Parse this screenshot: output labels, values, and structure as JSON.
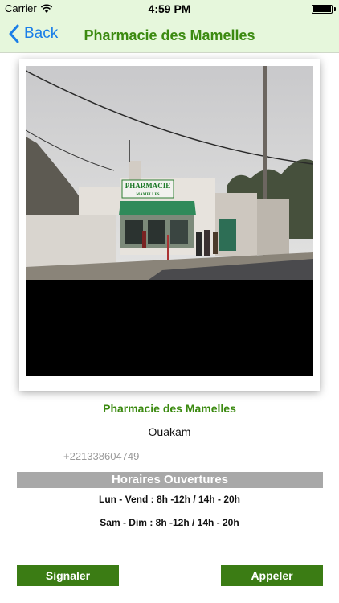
{
  "status_bar": {
    "carrier": "Carrier",
    "time": "4:59 PM",
    "battery_level": 1.0
  },
  "nav": {
    "back_label": "Back",
    "title": "Pharmacie des Mamelles"
  },
  "photo": {
    "sign_title": "PHARMACIE",
    "sign_subtitle": "MAMELLES"
  },
  "info": {
    "name": "Pharmacie des Mamelles",
    "district": "Ouakam",
    "phone": "+221338604749"
  },
  "hours": {
    "header": "Horaires Ouvertures",
    "weekdays": "Lun - Vend : 8h -12h  /  14h - 20h",
    "weekend": "Sam - Dim : 8h -12h  /  14h - 20h"
  },
  "actions": {
    "report_label": "Signaler",
    "call_label": "Appeler"
  },
  "colors": {
    "bar_background": "#e6f7dc",
    "accent_green": "#3b8a10",
    "button_green": "#3b7c14",
    "link_blue": "#1a7ee8",
    "hours_header": "#a8a8a8"
  }
}
